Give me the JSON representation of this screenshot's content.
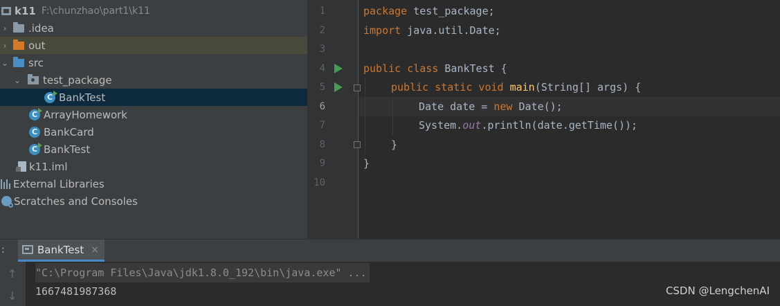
{
  "project_tree": {
    "root": {
      "name": "k11",
      "path": "F:\\chunzhao\\part1\\k11"
    },
    "items": [
      {
        "label": ".idea",
        "icon": "folder-icon"
      },
      {
        "label": "out",
        "icon": "folder-orange-icon"
      },
      {
        "label": "src",
        "icon": "source-folder-icon"
      },
      {
        "label": "test_package",
        "icon": "package-icon"
      },
      {
        "label": "BankTest",
        "icon": "java-class-icon",
        "selected": true
      },
      {
        "label": "ArrayHomework",
        "icon": "java-class-icon"
      },
      {
        "label": "BankCard",
        "icon": "java-class-icon"
      },
      {
        "label": "BankTest",
        "icon": "java-class-icon"
      },
      {
        "label": "k11.iml",
        "icon": "iml-file-icon"
      },
      {
        "label": "External Libraries",
        "icon": "libraries-icon"
      },
      {
        "label": "Scratches and Consoles",
        "icon": "scratches-icon"
      }
    ]
  },
  "editor": {
    "line_numbers": [
      "1",
      "2",
      "3",
      "4",
      "5",
      "6",
      "7",
      "8",
      "9",
      "10"
    ],
    "current_line": "6",
    "code": {
      "l1": {
        "kw": "package",
        "rest": " test_package;"
      },
      "l2": {
        "kw": "import",
        "rest": " java.util.Date;"
      },
      "l4": {
        "kw": "public class",
        "rest": " BankTest {"
      },
      "l5": {
        "kw": "public static void",
        "fn": "main",
        "rest": "(String[] args) {"
      },
      "l6": {
        "pre": "Date date = ",
        "kw": "new",
        "rest": " Date();"
      },
      "l7": {
        "pre": "System.",
        "fld": "out",
        "rest": ".println(date.getTime());"
      },
      "l8": {
        "rest": "}"
      },
      "l9": {
        "rest": "}"
      }
    }
  },
  "run_panel": {
    "prefix": ":",
    "tab_label": "BankTest",
    "tab_close": "×",
    "command_line": "\"C:\\Program Files\\Java\\jdk1.8.0_192\\bin\\java.exe\" ...",
    "output_line": "1667481987368"
  },
  "watermark": "CSDN @LengchenAI",
  "colors": {
    "keyword": "#cc7832",
    "function": "#ffc66d",
    "field": "#9876aa",
    "selection": "#0d293e",
    "run_icon": "#499c54"
  }
}
